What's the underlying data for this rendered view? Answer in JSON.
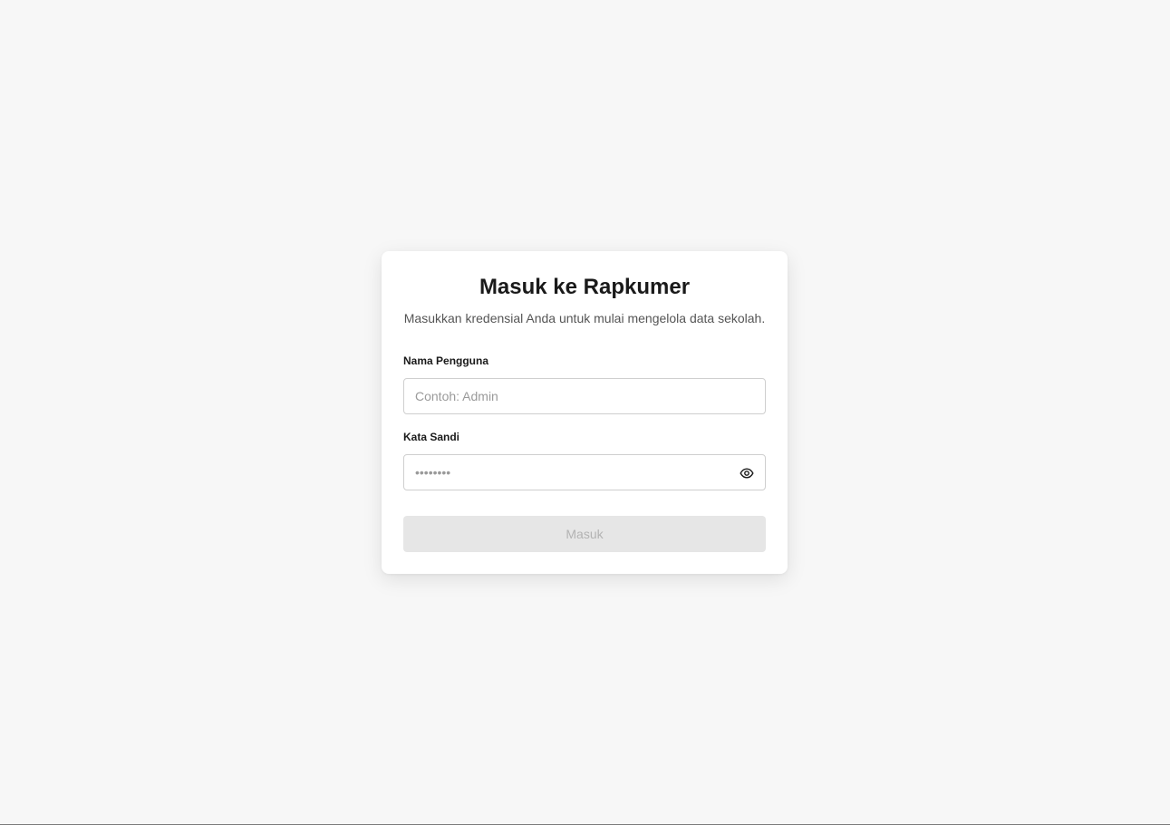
{
  "login": {
    "title": "Masuk ke Rapkumer",
    "subtitle": "Masukkan kredensial Anda untuk mulai mengelola data sekolah.",
    "username": {
      "label": "Nama Pengguna",
      "placeholder": "Contoh: Admin",
      "value": ""
    },
    "password": {
      "label": "Kata Sandi",
      "placeholder": "••••••••",
      "value": "",
      "toggle_icon": "eye-icon"
    },
    "submit_label": "Masuk",
    "submit_disabled": true
  },
  "colors": {
    "background": "#f7f7f7",
    "card": "#ffffff",
    "text": "#1a1a1a",
    "muted": "#555555",
    "button_disabled_bg": "#e6e6e6",
    "button_disabled_text": "#b3b3b3"
  }
}
